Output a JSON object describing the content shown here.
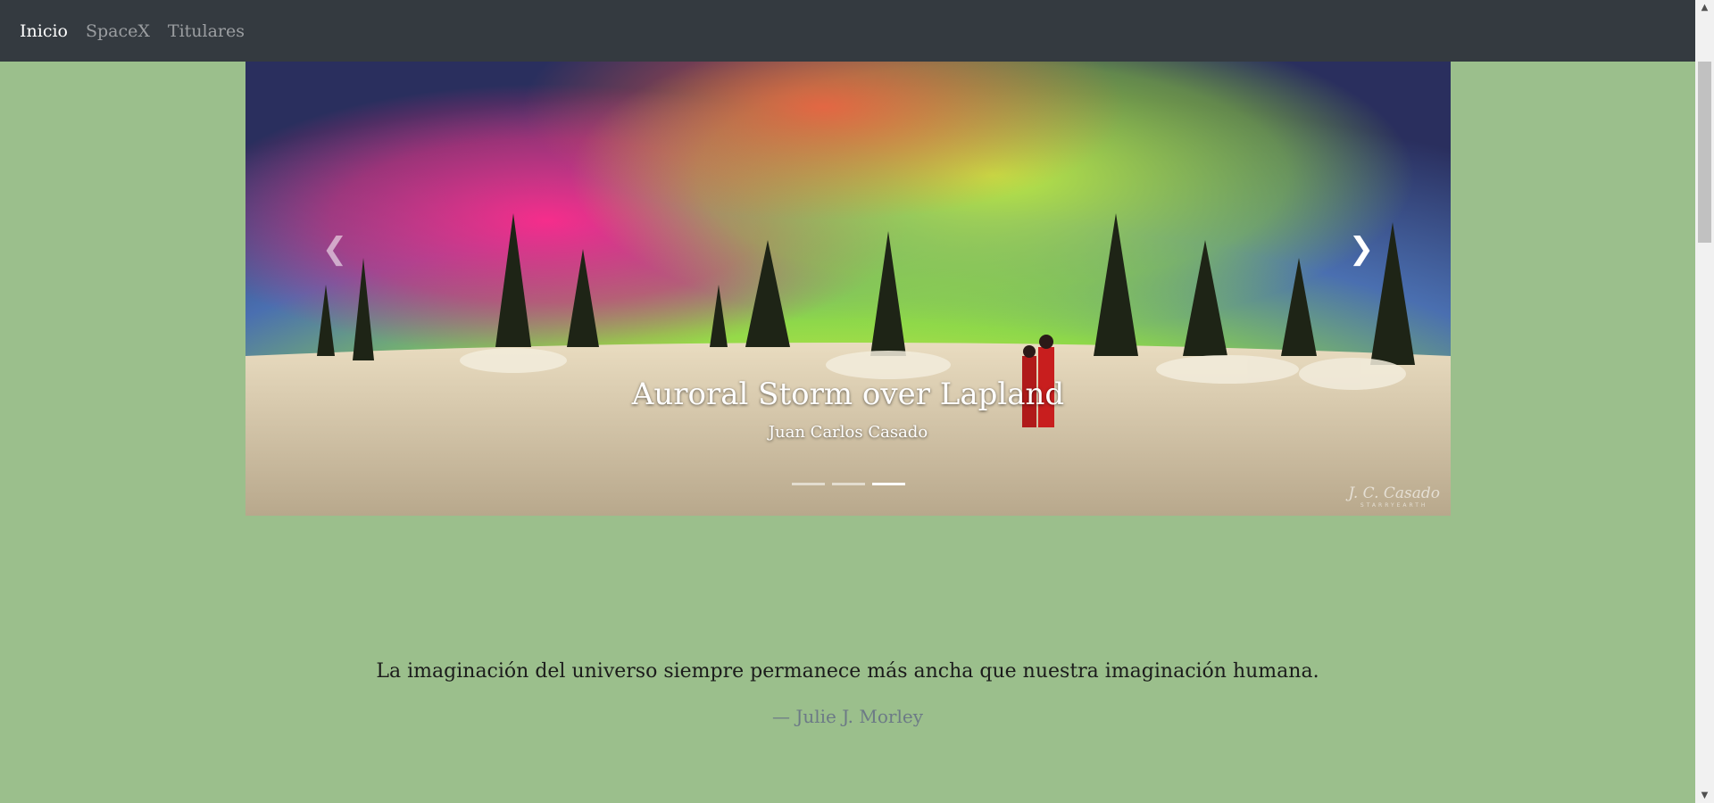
{
  "nav": {
    "items": [
      {
        "label": "Inicio",
        "active": true
      },
      {
        "label": "SpaceX",
        "active": false
      },
      {
        "label": "Titulares",
        "active": false
      }
    ]
  },
  "carousel": {
    "title": "Auroral Storm over Lapland",
    "author": "Juan Carlos Casado",
    "prev_icon": "chevron-left-icon",
    "next_icon": "chevron-right-icon",
    "prev_glyph": "❮",
    "next_glyph": "❯",
    "slide_count": 3,
    "active_slide": 3,
    "watermark": {
      "signature": "J. C. Casado",
      "subtitle": "STARRYEARTH"
    }
  },
  "quote": {
    "text": "La imaginación del universo siempre permanece más ancha que nuestra imaginación humana.",
    "author": "— Julie J. Morley"
  },
  "colors": {
    "page_background": "#9bbf8c",
    "navbar": "#343a40",
    "quote_author": "#6c7a86"
  },
  "scrollbar": {
    "up_glyph": "▲",
    "down_glyph": "▼"
  }
}
